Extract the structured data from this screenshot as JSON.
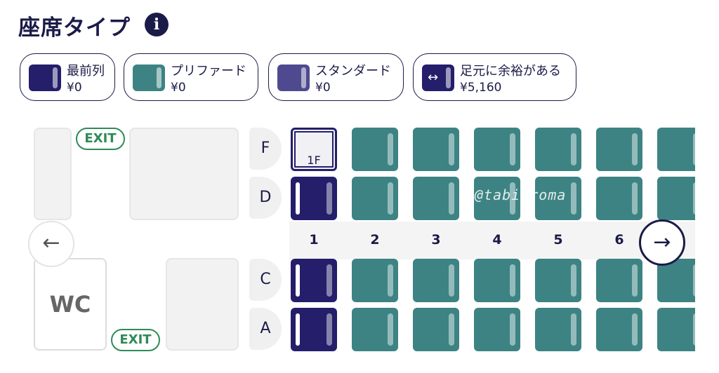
{
  "title": "座席タイプ",
  "info_icon": "i",
  "legend": [
    {
      "label": "最前列",
      "price": "¥0",
      "color": "#241e6b"
    },
    {
      "label": "プリファード",
      "price": "¥0",
      "color": "#3d8383"
    },
    {
      "label": "スタンダード",
      "price": "¥0",
      "color": "#4f4a8f"
    },
    {
      "label": "足元に余裕がある",
      "price": "¥5,160",
      "color": "#241e6b",
      "icon": "↔"
    }
  ],
  "exit_label": "EXIT",
  "wc_label": "WC",
  "rows": [
    "F",
    "D",
    "C",
    "A"
  ],
  "columns": [
    "1",
    "2",
    "3",
    "4",
    "5",
    "6"
  ],
  "selected_seat": "1F",
  "watermark": "@tabi roma",
  "nav": {
    "prev": "←",
    "next": "→"
  }
}
